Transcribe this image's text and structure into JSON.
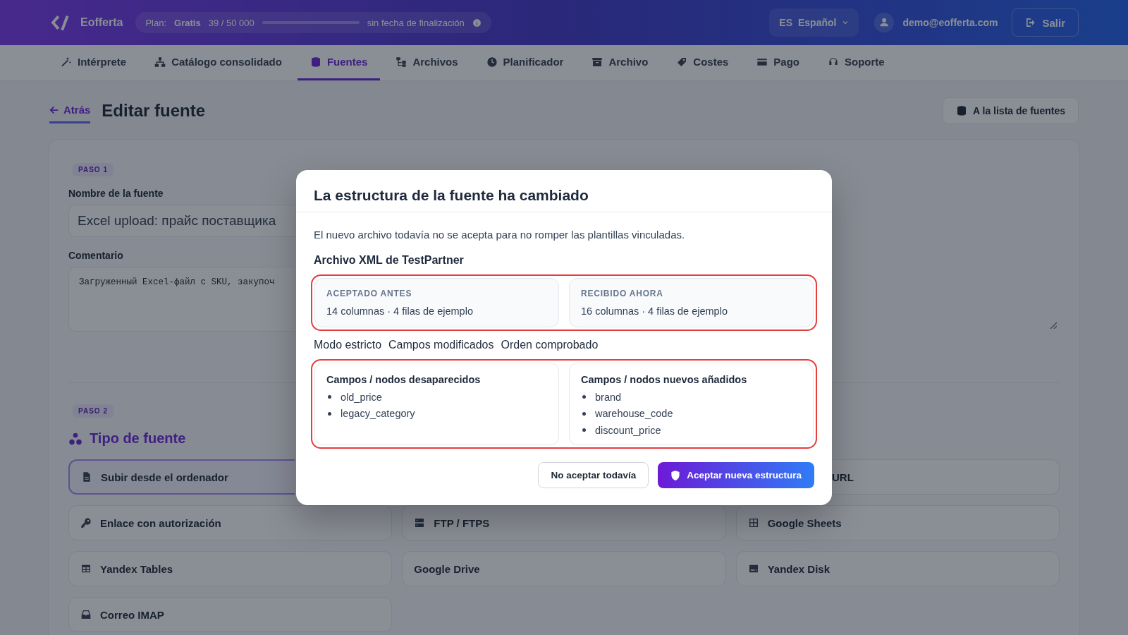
{
  "header": {
    "logo": "Eofferta",
    "plan": {
      "label": "Plan:",
      "name": "Gratis",
      "usage": "39 / 50 000",
      "expiry": "sin fecha de finalización"
    },
    "language": {
      "code": "ES",
      "label": "Español"
    },
    "user_email": "demo@eofferta.com",
    "logout": "Salir"
  },
  "nav_tabs": [
    {
      "label": "Intérprete",
      "selected": false
    },
    {
      "label": "Catálogo consolidado",
      "selected": false
    },
    {
      "label": "Fuentes",
      "selected": true
    },
    {
      "label": "Archivos",
      "selected": false
    },
    {
      "label": "Planificador",
      "selected": false
    },
    {
      "label": "Archivo",
      "selected": false
    },
    {
      "label": "Costes",
      "selected": false
    },
    {
      "label": "Pago",
      "selected": false
    },
    {
      "label": "Soporte",
      "selected": false
    }
  ],
  "page": {
    "back_link": "Atrás",
    "title": "Editar fuente",
    "list_button": "A la lista de fuentes",
    "step_1": {
      "badge": "PASO 1",
      "name_label": "Nombre de la fuente",
      "name_value": "Excel upload: прайс поставщика",
      "comment_label": "Comentario",
      "comment_value": "Загруженный Excel-файл с SKU, закупоч"
    },
    "step_2": {
      "badge": "PASO 2",
      "title": "Tipo de fuente",
      "options": [
        {
          "label": "Subir desde el ordenador",
          "selected": true,
          "kind": "cut_end"
        },
        {
          "label": "URL",
          "selected": false,
          "kind": "cut_start"
        },
        {
          "label": "Enlace con autorización",
          "selected": false,
          "kind": "full"
        },
        {
          "label": "FTP / FTPS",
          "selected": false,
          "kind": "full"
        },
        {
          "label": "Google Sheets",
          "selected": false,
          "kind": "full"
        },
        {
          "label": "Yandex Tables",
          "selected": false,
          "kind": "full"
        },
        {
          "label": "Google Drive",
          "selected": false,
          "kind": "full"
        },
        {
          "label": "Yandex Disk",
          "selected": false,
          "kind": "full"
        },
        {
          "label": "Correo IMAP",
          "selected": false,
          "kind": "full"
        }
      ]
    }
  },
  "dialog": {
    "title": "La estructura de la fuente ha cambiado",
    "message": "El nuevo archivo todavía no se acepta para no romper las plantillas vinculadas.",
    "source_name": "Archivo XML de TestPartner",
    "comparison": {
      "highlighted": true,
      "items": [
        {
          "label": "ACEPTADO ANTES",
          "summary": "14 columnas · 4 filas de ejemplo"
        },
        {
          "label": "RECIBIDO AHORA",
          "summary": "16 columnas · 4 filas de ejemplo"
        }
      ]
    },
    "flags": [
      "Modo estricto",
      "Campos modificados",
      "Orden comprobado"
    ],
    "changes": {
      "highlighted": true,
      "groups": [
        {
          "title": "Campos / nodos desaparecidos",
          "fields": [
            "old_price",
            "legacy_category"
          ]
        },
        {
          "title": "Campos / nodos nuevos añadidos",
          "fields": [
            "brand",
            "warehouse_code",
            "discount_price"
          ]
        }
      ]
    },
    "buttons": [
      {
        "label": "No aceptar todavía",
        "kind": "secondary"
      },
      {
        "label": "Aceptar nueva estructura",
        "kind": "primary"
      }
    ]
  }
}
